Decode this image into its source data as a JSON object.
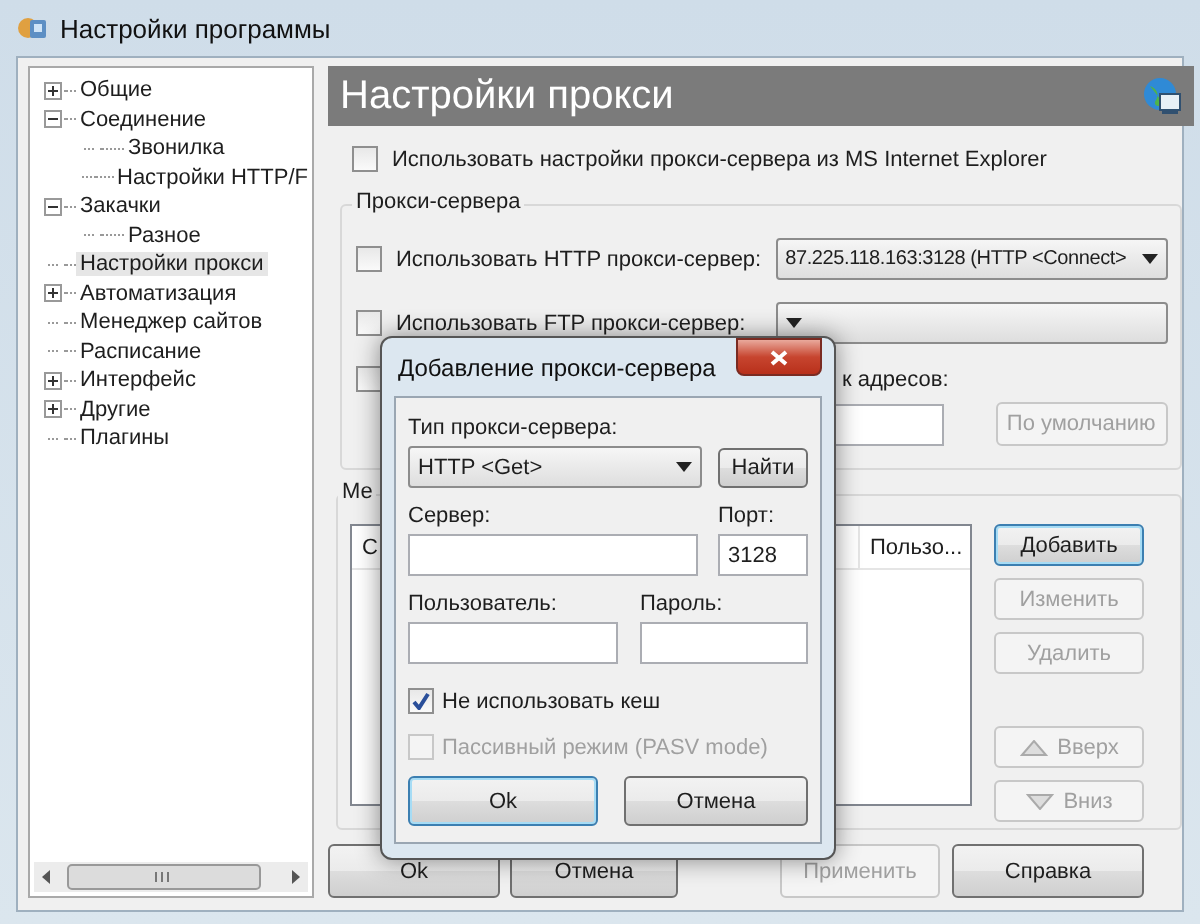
{
  "window": {
    "title": "Настройки программы"
  },
  "tree": [
    {
      "label": "Общие",
      "selected": false,
      "expanded": false
    },
    {
      "label": "Соединение",
      "selected": false,
      "expanded": true,
      "children": [
        {
          "label": "Звонилка",
          "selected": false
        },
        {
          "label": "Настройки HTTP/F",
          "selected": false
        }
      ]
    },
    {
      "label": "Закачки",
      "selected": false,
      "expanded": true,
      "children": [
        {
          "label": "Разное",
          "selected": false
        }
      ]
    },
    {
      "label": "Настройки прокси",
      "selected": true
    },
    {
      "label": "Автоматизация",
      "selected": false,
      "expanded": false
    },
    {
      "label": "Менеджер сайтов",
      "selected": false
    },
    {
      "label": "Расписание",
      "selected": false
    },
    {
      "label": "Интерфейс",
      "selected": false,
      "expanded": false
    },
    {
      "label": "Другие",
      "selected": false,
      "expanded": false
    },
    {
      "label": "Плагины",
      "selected": false
    }
  ],
  "page_title": "Настройки прокси",
  "ie_option": {
    "label": "Использовать настройки прокси-сервера из MS Internet Explorer",
    "checked": false
  },
  "proxy_group": {
    "title": "Прокси-сервера",
    "options": [
      {
        "label": "Использовать HTTP прокси-сервер:",
        "checked": false,
        "value": "87.225.118.163:3128 (HTTP <Connect>"
      },
      {
        "label": "Использовать FTP прокси-сервер:",
        "checked": false
      }
    ],
    "local_option": {
      "label": "к адресов:",
      "checked": false
    },
    "default_button": {
      "label": "По умолчанию",
      "disabled": true
    }
  },
  "list_group": {
    "title": "Ме",
    "columns": [
      "С",
      "Пользо..."
    ]
  },
  "list_buttons": [
    {
      "kind": "text",
      "label": "Добавить",
      "disabled": false,
      "default": true
    },
    {
      "kind": "text",
      "label": "Изменить",
      "disabled": true,
      "default": false
    },
    {
      "kind": "text",
      "label": "Удалить",
      "disabled": true,
      "default": false
    },
    {
      "kind": "up",
      "label": "Вверх",
      "disabled": true,
      "default": false
    },
    {
      "kind": "down",
      "label": "Вниз",
      "disabled": true,
      "default": false
    }
  ],
  "footer_buttons": [
    {
      "label": "Ok",
      "disabled": false
    },
    {
      "label": "Отмена",
      "disabled": false
    },
    {
      "label": "Применить",
      "disabled": true
    },
    {
      "label": "Справка",
      "disabled": false
    }
  ],
  "dialog": {
    "title": "Добавление прокси-сервера",
    "type_label": "Тип прокси-сервера:",
    "type_value": "HTTP <Get>",
    "find_button": "Найти",
    "server_label": "Сервер:",
    "port_label": "Порт:",
    "port_value": "3128",
    "user_label": "Пользователь:",
    "password_label": "Пароль:",
    "options": [
      {
        "label": "Не использовать кеш",
        "checked": true,
        "disabled": false
      },
      {
        "label": "Пассивный режим (PASV mode)",
        "checked": false,
        "disabled": true
      }
    ],
    "buttons": [
      {
        "label": "Ok",
        "default": true
      },
      {
        "label": "Отмена",
        "default": false
      }
    ]
  }
}
